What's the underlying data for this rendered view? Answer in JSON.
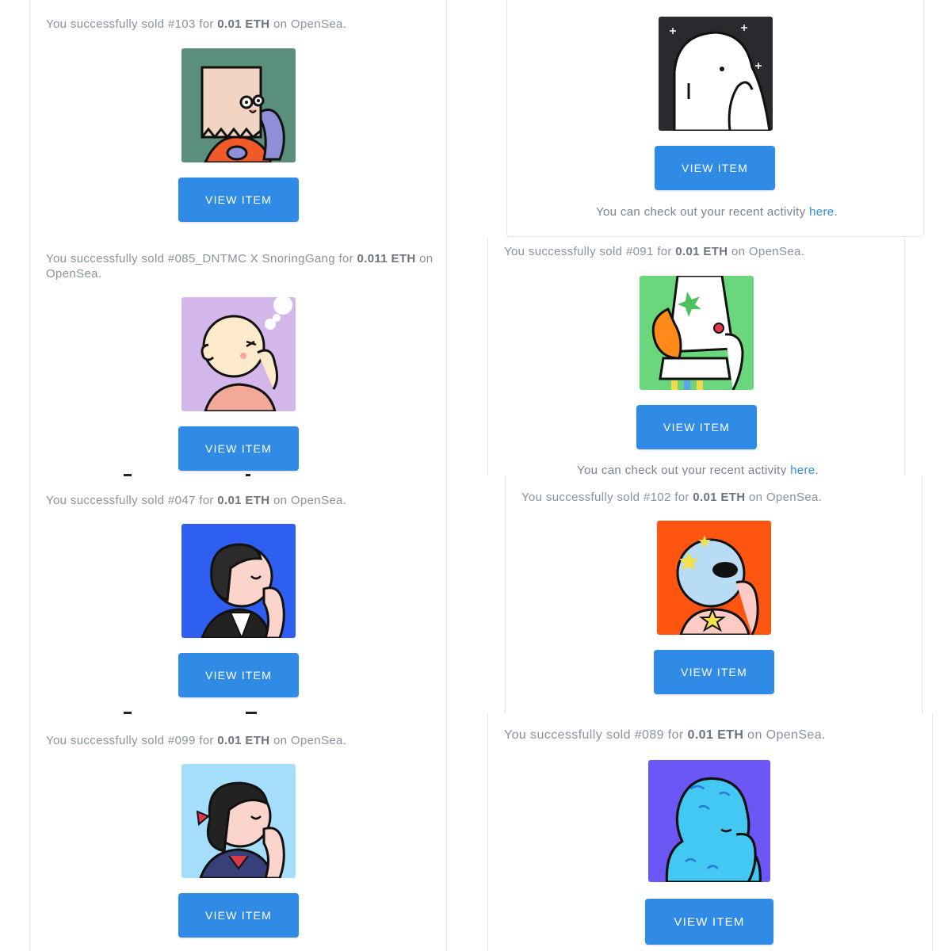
{
  "common": {
    "prefix": "You successfully sold ",
    "for_word": " for ",
    "on_word": " on ",
    "marketplace": "OpenSea",
    "period": ".",
    "button_label": "VIEW ITEM",
    "activity_text": "You can check out your recent activity ",
    "activity_link": "here",
    "activity_period": "."
  },
  "sales": [
    {
      "item": "#103",
      "price": "0.01 ETH",
      "bg": "#5a8f7b"
    },
    {
      "item": "#085_DNTMC X SnoringGang",
      "price": "0.011 ETH",
      "bg": "#d4b7ea"
    },
    {
      "item": "#047",
      "price": "0.01 ETH",
      "bg": "#2f5ff2"
    },
    {
      "item": "#099",
      "price": "0.01 ETH",
      "bg": "#a5defa"
    },
    {
      "item": "#091",
      "price": "0.01 ETH",
      "bg": "#6bd77c"
    },
    {
      "item": "#102",
      "price": "0.01 ETH",
      "bg": "#ff5510"
    },
    {
      "item": "#089",
      "price": "0.01 ETH",
      "bg": "#6c56f6"
    }
  ],
  "top_right_art_bg": "#2a2a2e",
  "colors": {
    "button": "#2f8be6",
    "link": "#2f8be6",
    "text": "#8a929c",
    "border": "#e3e6ee"
  }
}
